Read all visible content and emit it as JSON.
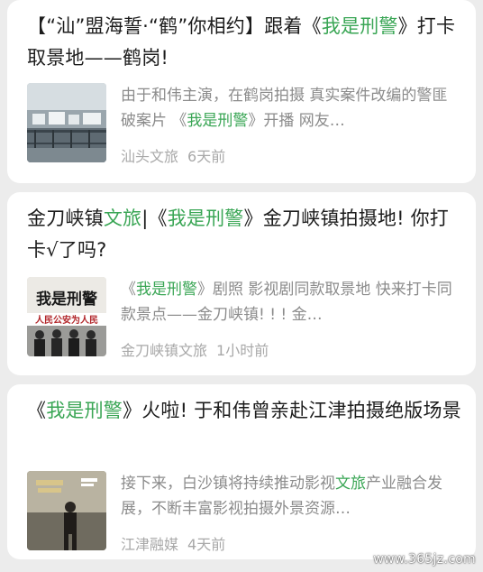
{
  "articles": [
    {
      "title_parts": [
        {
          "text": "【“汕”盟海誓·“鹤”你相约】跟着《",
          "highlight": false
        },
        {
          "text": "我是刑警",
          "highlight": true
        },
        {
          "text": "》打卡取景地——鹤岗!",
          "highlight": false
        }
      ],
      "snippet_parts": [
        {
          "text": "由于和伟主演，在鹤岗拍摄 真实案件改编的警匪破案片 《",
          "highlight": false
        },
        {
          "text": "我是刑警",
          "highlight": true
        },
        {
          "text": "》开播 网友…",
          "highlight": false
        }
      ],
      "source": "汕头文旅",
      "time": "6天前",
      "thumb_icon": "snowy-town-photo"
    },
    {
      "title_parts": [
        {
          "text": "金刀峡镇",
          "highlight": false
        },
        {
          "text": "文旅",
          "highlight": true
        },
        {
          "text": "|《",
          "highlight": false
        },
        {
          "text": "我是刑警",
          "highlight": true
        },
        {
          "text": "》金刀峡镇拍摄地! 你打卡√了吗?",
          "highlight": false
        }
      ],
      "snippet_parts": [
        {
          "text": "《",
          "highlight": false
        },
        {
          "text": "我是刑警",
          "highlight": true
        },
        {
          "text": "》剧照 影视剧同款取景地 快来打卡同款景点——金刀峡镇! ! ! 金…",
          "highlight": false
        }
      ],
      "source": "金刀峡镇文旅",
      "time": "1小时前",
      "thumb_icon": "drama-poster-photo",
      "thumb_text": {
        "calligraphy": "我是刑警",
        "banner": "人民公安为人民"
      }
    },
    {
      "title_parts": [
        {
          "text": "《",
          "highlight": false
        },
        {
          "text": "我是刑警",
          "highlight": true
        },
        {
          "text": "》火啦! 于和伟曾亲赴江津拍摄绝版场景",
          "highlight": false
        }
      ],
      "snippet_parts": [
        {
          "text": "接下来，白沙镇将持续推动影视",
          "highlight": false
        },
        {
          "text": "文旅",
          "highlight": true
        },
        {
          "text": "产业融合发展，不断丰富影视拍摄外景资源…",
          "highlight": false
        }
      ],
      "source": "江津融媒",
      "time": "4天前",
      "thumb_icon": "actor-poster-photo"
    }
  ],
  "watermark": "www.365jz.com",
  "colors": {
    "highlight": "#3aa655",
    "title": "#1c1c1c",
    "snippet": "#8b8b8b",
    "meta": "#a8a8a8",
    "background": "#ececec",
    "card": "#ffffff"
  }
}
